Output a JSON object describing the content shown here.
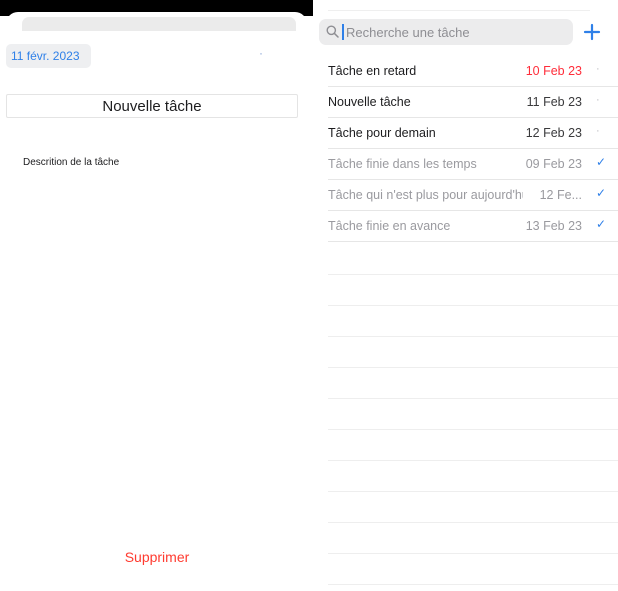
{
  "editor": {
    "date": "11 févr. 2023",
    "title_value": "Nouvelle tâche",
    "description_label": "Descrition de la tâche",
    "delete_label": "Supprimer"
  },
  "list": {
    "search_placeholder": "Recherche une tâche",
    "add_icon": "+",
    "tasks": [
      {
        "title": "Tâche en retard",
        "date": "10 Feb 23",
        "status": "·",
        "state": "overdue"
      },
      {
        "title": "Nouvelle tâche",
        "date": "11 Feb 23",
        "status": "·",
        "state": "pending"
      },
      {
        "title": "Tâche pour demain",
        "date": "12 Feb 23",
        "status": "·",
        "state": "pending"
      },
      {
        "title": "Tâche finie dans les temps",
        "date": "09 Feb 23",
        "status": "✓",
        "state": "done"
      },
      {
        "title": "Tâche qui n'est plus pour aujourd'hui",
        "date": "12 Fe...",
        "status": "✓",
        "state": "done"
      },
      {
        "title": "Tâche finie en avance",
        "date": "13 Feb 23",
        "status": "✓",
        "state": "done"
      }
    ]
  },
  "colors": {
    "accent": "#2f80e8",
    "destructive": "#ff3b30",
    "overdue": "#ff2d3a"
  }
}
